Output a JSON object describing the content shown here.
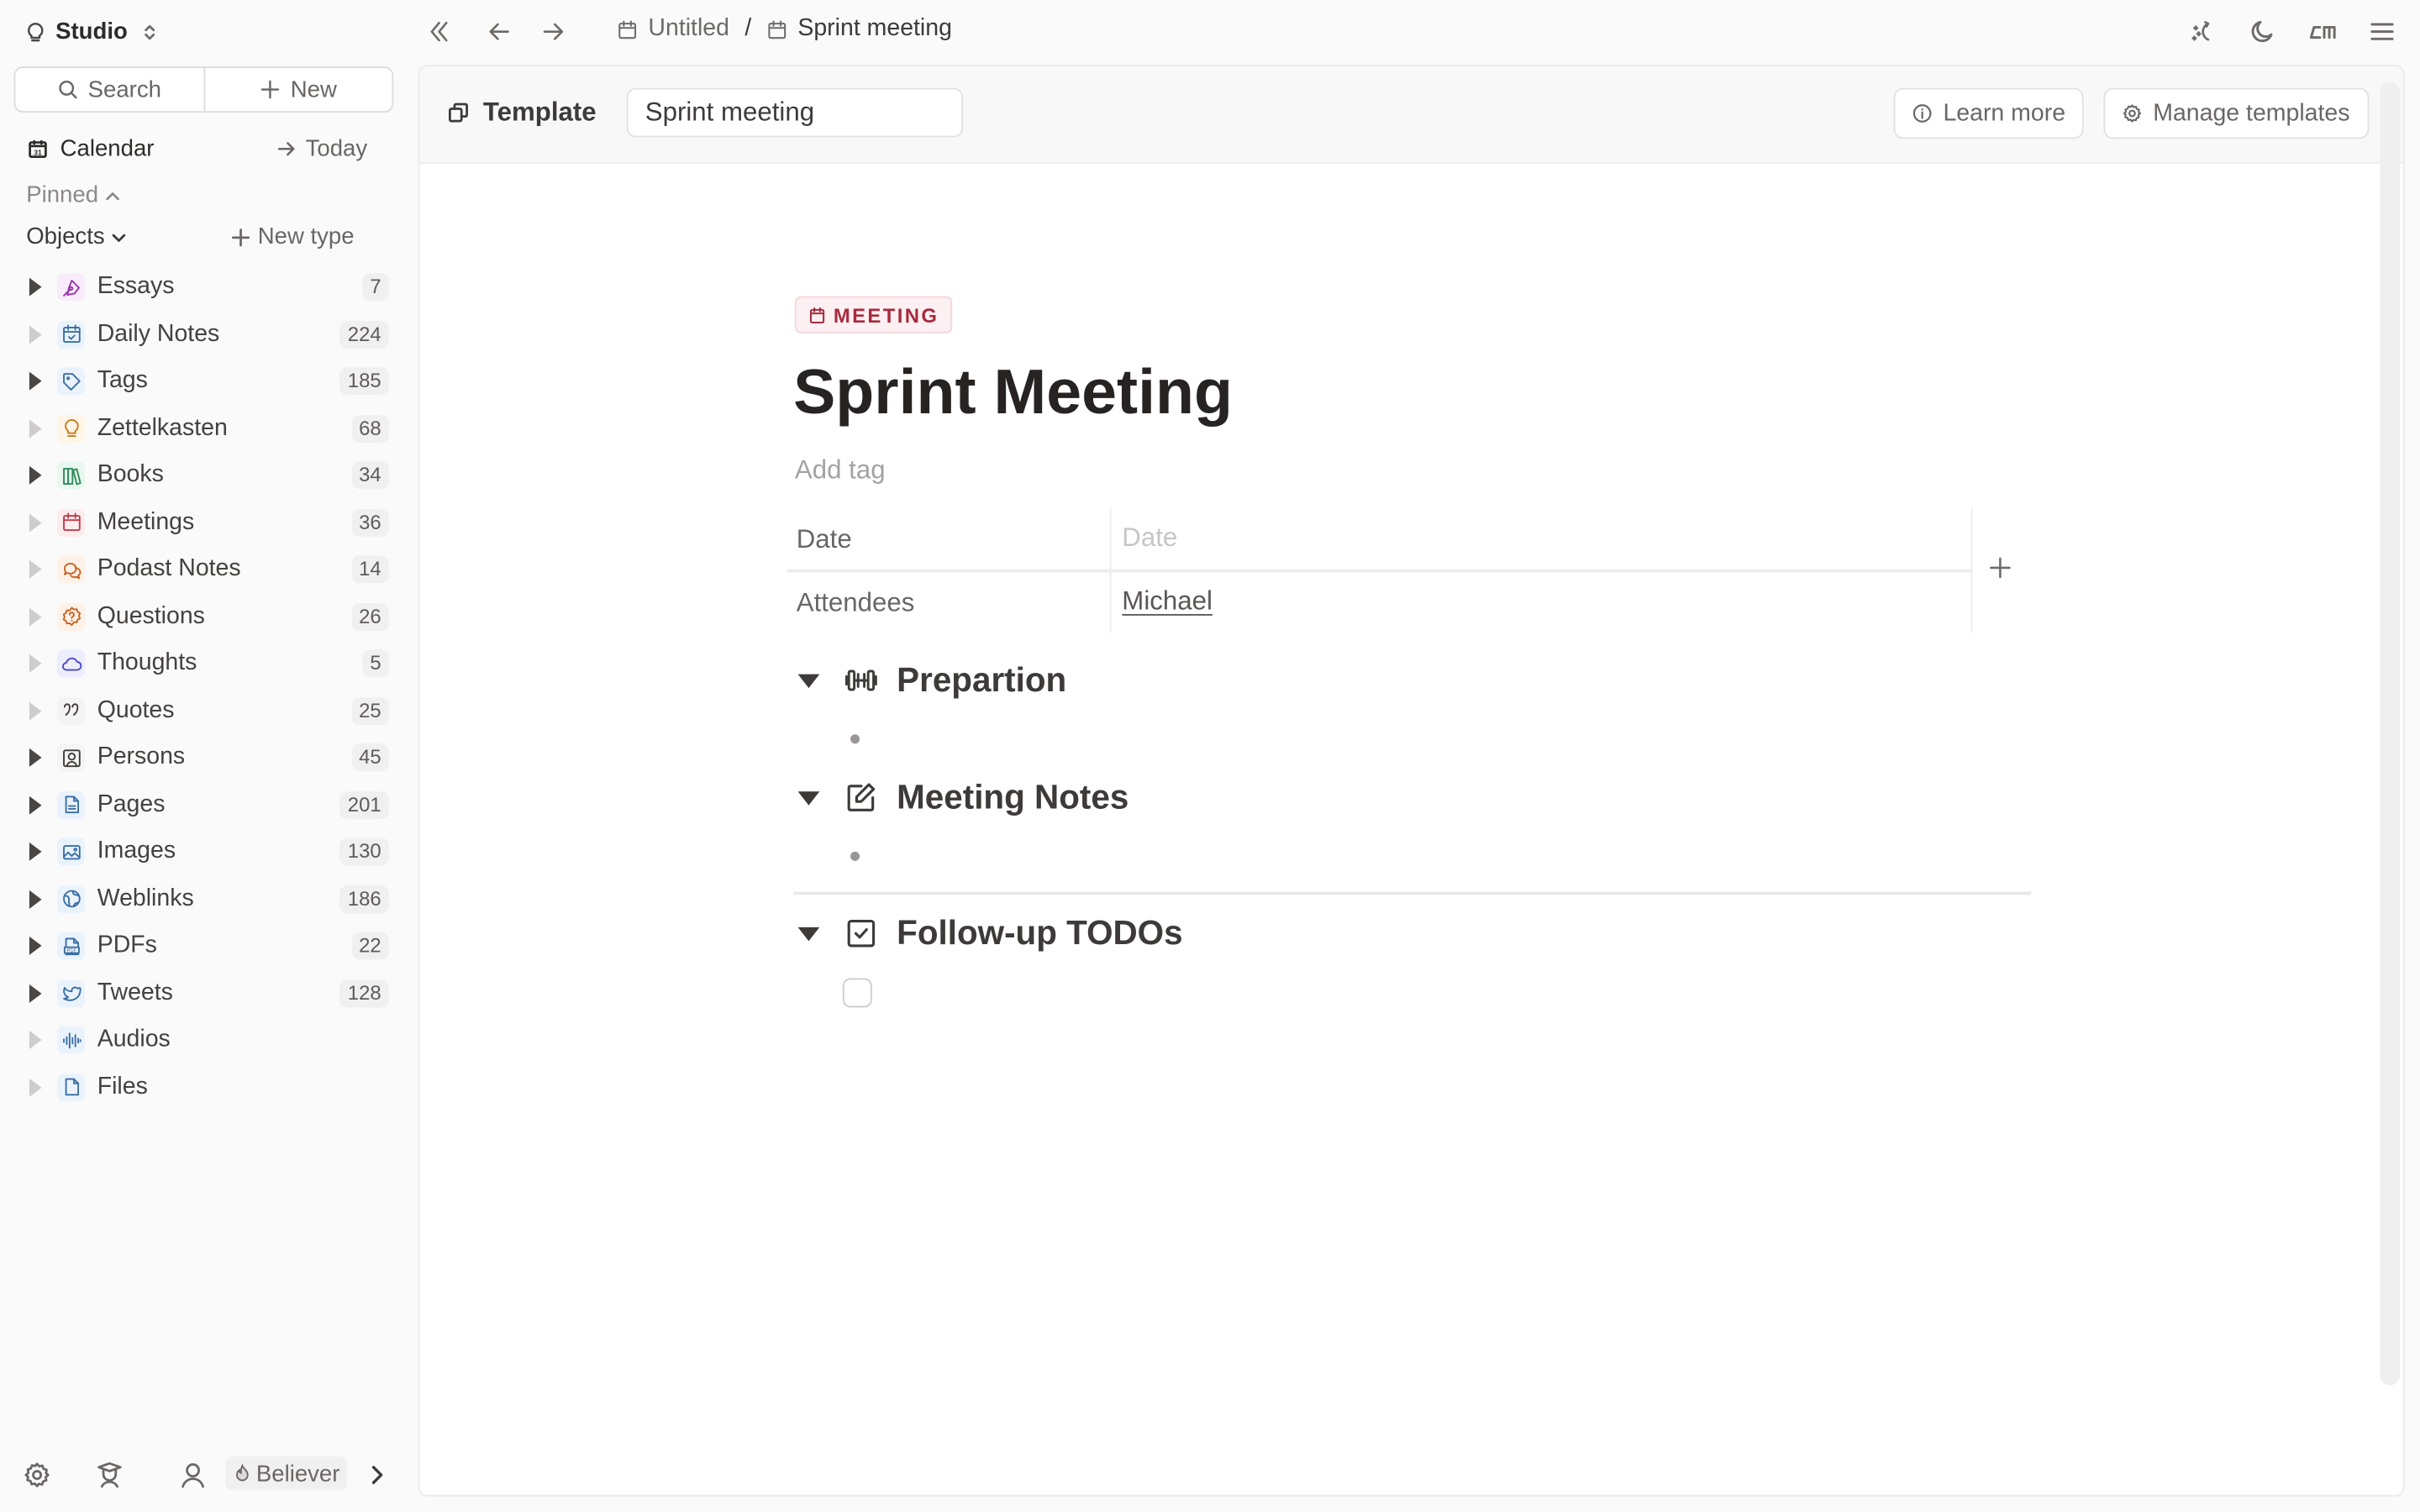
{
  "workspace": {
    "name": "Studio",
    "icon": "lightbulb-icon"
  },
  "sidebar": {
    "search_label": "Search",
    "new_label": "New",
    "calendar_label": "Calendar",
    "today_label": "Today",
    "pinned_label": "Pinned",
    "objects_label": "Objects",
    "new_type_label": "New type",
    "objects": [
      {
        "label": "Essays",
        "count": "7",
        "icon": "pen-nib-icon",
        "color": "#9b2fae",
        "bg": "#f8ecfb",
        "has_children": true
      },
      {
        "label": "Daily Notes",
        "count": "224",
        "icon": "calendar-check-icon",
        "color": "#3a6ea5",
        "bg": "#eaf3fc",
        "has_children": false
      },
      {
        "label": "Tags",
        "count": "185",
        "icon": "tag-icon",
        "color": "#3a6ea5",
        "bg": "#eaf3fc",
        "has_children": true
      },
      {
        "label": "Zettelkasten",
        "count": "68",
        "icon": "lightbulb-icon",
        "color": "#c77a1c",
        "bg": "#fdf5e6",
        "has_children": false
      },
      {
        "label": "Books",
        "count": "34",
        "icon": "books-icon",
        "color": "#2f8a5a",
        "bg": "#e8f7ef",
        "has_children": true
      },
      {
        "label": "Meetings",
        "count": "36",
        "icon": "calendar-icon",
        "color": "#c23a4d",
        "bg": "#fcecee",
        "has_children": false
      },
      {
        "label": "Podast Notes",
        "count": "14",
        "icon": "chat-bubbles-icon",
        "color": "#c9621d",
        "bg": "#fdf1e8",
        "has_children": false
      },
      {
        "label": "Questions",
        "count": "26",
        "icon": "question-badge-icon",
        "color": "#c9621d",
        "bg": "#fdf1e8",
        "has_children": false
      },
      {
        "label": "Thoughts",
        "count": "5",
        "icon": "cloud-icon",
        "color": "#4a47c4",
        "bg": "#eeedfc",
        "has_children": false
      },
      {
        "label": "Quotes",
        "count": "25",
        "icon": "quote-icon",
        "color": "#3d3a39",
        "bg": "#f4f4f4",
        "has_children": false
      },
      {
        "label": "Persons",
        "count": "45",
        "icon": "person-portrait-icon",
        "color": "#3d3a39",
        "bg": "#f4f4f4",
        "has_children": true
      },
      {
        "label": "Pages",
        "count": "201",
        "icon": "document-icon",
        "color": "#3a6ea5",
        "bg": "#eaf3fc",
        "has_children": true
      },
      {
        "label": "Images",
        "count": "130",
        "icon": "image-icon",
        "color": "#3a6ea5",
        "bg": "#eaf3fc",
        "has_children": true
      },
      {
        "label": "Weblinks",
        "count": "186",
        "icon": "globe-icon",
        "color": "#3a6ea5",
        "bg": "#eaf3fc",
        "has_children": true
      },
      {
        "label": "PDFs",
        "count": "22",
        "icon": "pdf-file-icon",
        "color": "#3a6ea5",
        "bg": "#eaf3fc",
        "has_children": true
      },
      {
        "label": "Tweets",
        "count": "128",
        "icon": "bird-icon",
        "color": "#3a6ea5",
        "bg": "#eaf3fc",
        "has_children": true
      },
      {
        "label": "Audios",
        "count": "",
        "icon": "audio-wave-icon",
        "color": "#3a6ea5",
        "bg": "#eaf3fc",
        "has_children": false
      },
      {
        "label": "Files",
        "count": "",
        "icon": "file-icon",
        "color": "#3a6ea5",
        "bg": "#eaf3fc",
        "has_children": false
      }
    ],
    "footer": {
      "plan_label": "Believer"
    }
  },
  "topbar": {
    "breadcrumb": [
      {
        "label": "Untitled",
        "icon": "calendar-icon"
      },
      {
        "label": "Sprint meeting",
        "icon": "calendar-icon"
      }
    ],
    "separator": "/"
  },
  "template_bar": {
    "label": "Template",
    "name_value": "Sprint meeting",
    "learn_more_label": "Learn more",
    "manage_label": "Manage templates"
  },
  "document": {
    "type_tag": "MEETING",
    "type_color": "#a82a3e",
    "title": "Sprint Meeting",
    "add_tag_placeholder": "Add tag",
    "properties": [
      {
        "key": "Date",
        "value": "",
        "placeholder": "Date"
      },
      {
        "key": "Attendees",
        "value": "Michael",
        "placeholder": ""
      }
    ],
    "sections": [
      {
        "title": "Prepartion",
        "icon": "dumbbell-icon",
        "content": "bullet"
      },
      {
        "title": "Meeting Notes",
        "icon": "edit-note-icon",
        "content": "bullet"
      },
      {
        "title": "Follow-up TODOs",
        "icon": "checkbox-checked-icon",
        "content": "todo"
      }
    ]
  }
}
